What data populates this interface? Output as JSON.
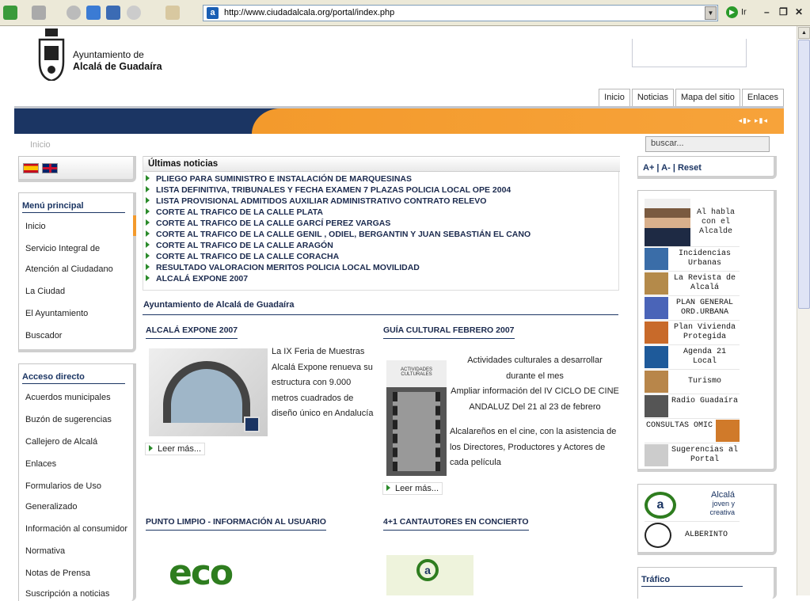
{
  "browser": {
    "url": "http://www.ciudadalcala.org/portal/index.php",
    "go_label": "Ir"
  },
  "header": {
    "logo_line1": "Ayuntamiento de",
    "logo_line2": "Alcalá de Guadaíra",
    "nav": [
      "Inicio",
      "Noticias",
      "Mapa del sitio",
      "Enlaces"
    ]
  },
  "breadcrumb": "Inicio",
  "search": {
    "placeholder": "buscar..."
  },
  "font_controls": "A+ | A- | Reset",
  "menu": {
    "title": "Menú principal",
    "items": [
      "Inicio",
      "Servicio Integral de",
      "Atención al Ciudadano",
      "La Ciudad",
      "El Ayuntamiento",
      "Buscador"
    ]
  },
  "acceso": {
    "title": "Acceso directo",
    "items": [
      "Acuerdos municipales",
      "Buzón de sugerencias",
      "Callejero de Alcalá",
      "Enlaces",
      "Formularios de Uso",
      "Generalizado",
      "Información al consumidor",
      "Normativa",
      "Notas de Prensa",
      "Suscripción a noticias"
    ]
  },
  "news": {
    "title": "Últimas noticias",
    "items": [
      "PLIEGO PARA SUMINISTRO E INSTALACIÓN DE MARQUESINAS",
      "LISTA DEFINITIVA, TRIBUNALES Y FECHA EXAMEN 7 PLAZAS POLICIA LOCAL OPE 2004",
      "LISTA PROVISIONAL ADMITIDOS AUXILIAR ADMINISTRATIVO CONTRATO RELEVO",
      "CORTE AL TRAFICO DE LA CALLE PLATA",
      "CORTE AL TRAFICO DE LA CALLE GARCÍ PEREZ VARGAS",
      "CORTE AL TRAFICO DE LA CALLE GENIL , ODIEL, BERGANTIN Y JUAN SEBASTIÁN EL CANO",
      "CORTE AL TRAFICO DE LA CALLE ARAGÓN",
      "CORTE AL TRAFICO DE LA CALLE CORACHA",
      "RESULTADO VALORACION MERITOS POLICIA LOCAL MOVILIDAD",
      "ALCALÁ EXPONE 2007"
    ]
  },
  "section_title": "Ayuntamiento de Alcalá de Guadaíra",
  "articles": {
    "a1": {
      "title": "ALCALÁ EXPONE 2007",
      "lines": [
        "La IX Feria de Muestras",
        "Alcalá Expone renueva su",
        "estructura con 9.000",
        "metros cuadrados de",
        "diseño único en Andalucía"
      ],
      "more": "Leer más..."
    },
    "a2": {
      "title": "GUÍA CULTURAL FEBRERO 2007",
      "lines": [
        "Actividades culturales a desarrollar",
        "durante el mes",
        "Ampliar información del IV CICLO DE CINE",
        "ANDALUZ Del 21 al 23 de febrero"
      ],
      "lines2": [
        "Alcalareños en el cine, con la asistencia de",
        "los Directores, Productores y Actores de",
        "cada película"
      ],
      "more": "Leer más...",
      "poster_text": "ACTIVIDADES CULTURALES"
    },
    "a3": {
      "title": "PUNTO LIMPIO - INFORMACIÓN AL USUARIO",
      "logo": "eco"
    },
    "a4": {
      "title": "4+1 CANTAUTORES EN CONCIERTO",
      "logo": "a"
    }
  },
  "right": {
    "alcalde": "Al habla con el Alcalde",
    "links": [
      "Incidencias Urbanas",
      "La Revista de Alcalá",
      "PLAN GENERAL ORD.URBANA",
      "Plan Vivienda Protegida",
      "Agenda 21 Local",
      "Turismo",
      "Radio Guadaíra",
      "CONSULTAS OMIC",
      "Sugerencias al Portal"
    ],
    "joven": {
      "line1": "Alcalá",
      "line2": "joven y",
      "line3": "creativa",
      "logo": "a"
    },
    "alberinto": "ALBERINTO",
    "trafico": "Tráfico"
  },
  "colors": {
    "navy": "#1b3563",
    "orange": "#f39a2c",
    "green": "#2a8a2a"
  }
}
